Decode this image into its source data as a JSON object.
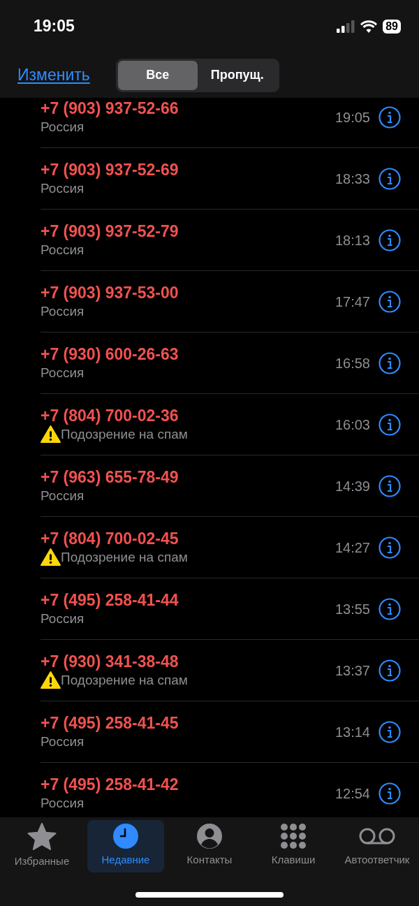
{
  "status_bar": {
    "time": "19:05",
    "battery": "89"
  },
  "nav": {
    "edit": "Изменить",
    "segments": [
      {
        "label": "Все",
        "selected": true
      },
      {
        "label": "Пропущ.",
        "selected": false
      }
    ]
  },
  "calls": [
    {
      "number": "+7 (903) 937-52-66",
      "kind": "region",
      "subtitle": "Россия",
      "time": "19:05",
      "missed": true
    },
    {
      "number": "+7 (903) 937-52-69",
      "kind": "region",
      "subtitle": "Россия",
      "time": "18:33",
      "missed": true
    },
    {
      "number": "+7 (903) 937-52-79",
      "kind": "region",
      "subtitle": "Россия",
      "time": "18:13",
      "missed": true
    },
    {
      "number": "+7 (903) 937-53-00",
      "kind": "region",
      "subtitle": "Россия",
      "time": "17:47",
      "missed": true
    },
    {
      "number": "+7 (930) 600-26-63",
      "kind": "region",
      "subtitle": "Россия",
      "time": "16:58",
      "missed": true
    },
    {
      "number": "+7 (804) 700-02-36",
      "kind": "spam",
      "subtitle": "Подозрение на спам",
      "time": "16:03",
      "missed": true
    },
    {
      "number": "+7 (963) 655-78-49",
      "kind": "region",
      "subtitle": "Россия",
      "time": "14:39",
      "missed": true
    },
    {
      "number": "+7 (804) 700-02-45",
      "kind": "spam",
      "subtitle": "Подозрение на спам",
      "time": "14:27",
      "missed": true
    },
    {
      "number": "+7 (495) 258-41-44",
      "kind": "region",
      "subtitle": "Россия",
      "time": "13:55",
      "missed": true
    },
    {
      "number": "+7 (930) 341-38-48",
      "kind": "spam",
      "subtitle": "Подозрение на спам",
      "time": "13:37",
      "missed": true
    },
    {
      "number": "+7 (495) 258-41-45",
      "kind": "region",
      "subtitle": "Россия",
      "time": "13:14",
      "missed": true
    },
    {
      "number": "+7 (495) 258-41-42",
      "kind": "region",
      "subtitle": "Россия",
      "time": "12:54",
      "missed": true
    }
  ],
  "tab_bar": [
    {
      "kind": "favorites",
      "label": "Избранные",
      "selected": false
    },
    {
      "kind": "recents",
      "label": "Недавние",
      "selected": true
    },
    {
      "kind": "contacts",
      "label": "Контакты",
      "selected": false
    },
    {
      "kind": "keypad",
      "label": "Клавиши",
      "selected": false
    },
    {
      "kind": "voicemail",
      "label": "Автоответчик",
      "selected": false
    }
  ]
}
